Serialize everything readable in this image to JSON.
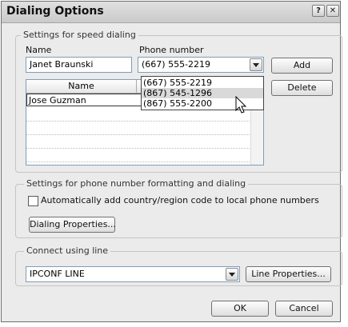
{
  "window": {
    "title": "Dialing Options",
    "help_glyph": "?",
    "close_glyph": "✕"
  },
  "speed_dialing": {
    "group_label": "Settings for speed dialing",
    "name_label": "Name",
    "phone_label": "Phone number",
    "name_value": "Janet Braunski",
    "phone_value": "(667) 555-2219",
    "add_label": "Add",
    "delete_label": "Delete",
    "list_header_name": "Name",
    "entries": [
      {
        "name": "Jose Guzman"
      }
    ],
    "dropdown_options": [
      "(667) 555-2219",
      "(867) 545-1296",
      "(867) 555-2200"
    ],
    "highlighted_option": "(867) 545-1296"
  },
  "formatting": {
    "group_label": "Settings for phone number formatting and dialing",
    "checkbox_label": "Automatically add country/region code to local phone numbers",
    "checkbox_checked": false,
    "dialing_properties_label": "Dialing Properties..."
  },
  "connect": {
    "group_label": "Connect using line",
    "line_value": "IPCONF LINE",
    "line_properties_label": "Line Properties..."
  },
  "footer": {
    "ok_label": "OK",
    "cancel_label": "Cancel"
  }
}
